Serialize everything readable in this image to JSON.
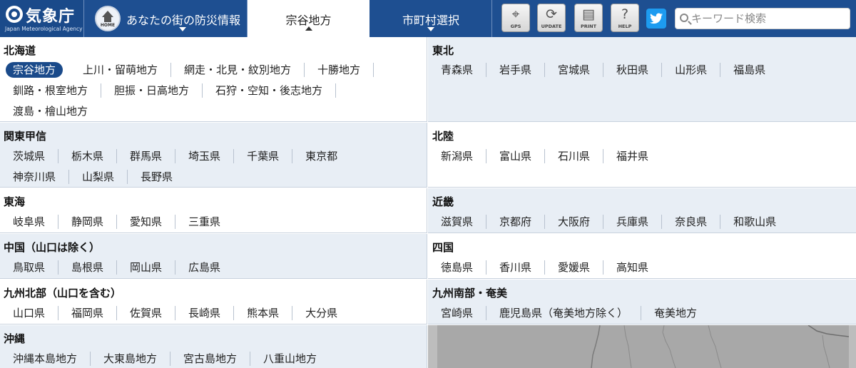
{
  "header": {
    "logo_text": "気象庁",
    "logo_sub": "Japan Meteorological Agency",
    "home_icon_label": "HOME",
    "home_label": "あなたの街の防災情報",
    "region_tab": "宗谷地方",
    "city_tab": "市町村選択",
    "tools": [
      {
        "icon": "gps-icon",
        "label": "GPS"
      },
      {
        "icon": "update-icon",
        "label": "UPDATE"
      },
      {
        "icon": "print-icon",
        "label": "PRINT"
      },
      {
        "icon": "help-icon",
        "label": "HELP"
      }
    ],
    "twitter_icon": "twitter-icon",
    "search_placeholder": "キーワード検索"
  },
  "regions": {
    "hokkaido": {
      "title": "北海道",
      "rows": [
        [
          "宗谷地方",
          "上川・留萌地方",
          "網走・北見・紋別地方",
          "十勝地方"
        ],
        [
          "釧路・根室地方",
          "胆振・日高地方",
          "石狩・空知・後志地方"
        ],
        [
          "渡島・檜山地方"
        ]
      ],
      "selected": "宗谷地方"
    },
    "tohoku": {
      "title": "東北",
      "rows": [
        [
          "青森県",
          "岩手県",
          "宮城県",
          "秋田県",
          "山形県",
          "福島県"
        ]
      ]
    },
    "kanto": {
      "title": "関東甲信",
      "rows": [
        [
          "茨城県",
          "栃木県",
          "群馬県",
          "埼玉県",
          "千葉県",
          "東京都"
        ],
        [
          "神奈川県",
          "山梨県",
          "長野県"
        ]
      ]
    },
    "hokuriku": {
      "title": "北陸",
      "rows": [
        [
          "新潟県",
          "富山県",
          "石川県",
          "福井県"
        ]
      ]
    },
    "tokai": {
      "title": "東海",
      "rows": [
        [
          "岐阜県",
          "静岡県",
          "愛知県",
          "三重県"
        ]
      ]
    },
    "kinki": {
      "title": "近畿",
      "rows": [
        [
          "滋賀県",
          "京都府",
          "大阪府",
          "兵庫県",
          "奈良県",
          "和歌山県"
        ]
      ]
    },
    "chugoku": {
      "title": "中国（山口は除く）",
      "rows": [
        [
          "鳥取県",
          "島根県",
          "岡山県",
          "広島県"
        ]
      ]
    },
    "shikoku": {
      "title": "四国",
      "rows": [
        [
          "徳島県",
          "香川県",
          "愛媛県",
          "高知県"
        ]
      ]
    },
    "kyushu_north": {
      "title": "九州北部（山口を含む）",
      "rows": [
        [
          "山口県",
          "福岡県",
          "佐賀県",
          "長崎県",
          "熊本県",
          "大分県"
        ]
      ]
    },
    "kyushu_south": {
      "title": "九州南部・奄美",
      "rows": [
        [
          "宮崎県",
          "鹿児島県（奄美地方除く）",
          "奄美地方"
        ]
      ]
    },
    "okinawa": {
      "title": "沖縄",
      "rows": [
        [
          "沖縄本島地方",
          "大東島地方",
          "宮古島地方",
          "八重山地方"
        ]
      ]
    }
  },
  "colors": {
    "header_bg": "#1e4f91",
    "selected_bg": "#1a4a8a",
    "panel_shade": "#e8eef5"
  }
}
